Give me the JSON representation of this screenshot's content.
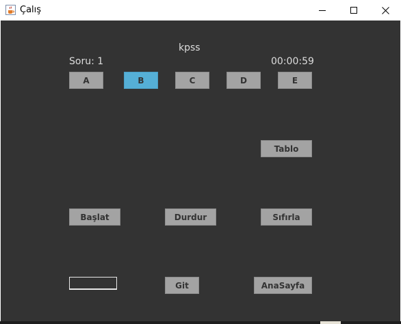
{
  "window": {
    "title": "Çalış",
    "icon": "java-coffee-cup-icon",
    "controls": [
      "minimize-icon",
      "maximize-icon",
      "close-icon"
    ]
  },
  "main": {
    "heading": "kpss",
    "question_label": "Soru: 1",
    "timer": "00:00:59",
    "options": [
      {
        "label": "A",
        "selected": false
      },
      {
        "label": "B",
        "selected": true
      },
      {
        "label": "C",
        "selected": false
      },
      {
        "label": "D",
        "selected": false
      },
      {
        "label": "E",
        "selected": false
      }
    ],
    "buttons": {
      "tablo": "Tablo",
      "baslat": "Başlat",
      "durdur": "Durdur",
      "sifirla": "Sıfırla",
      "git": "Git",
      "anasayfa": "AnaSayfa"
    },
    "goto_input": {
      "value": ""
    }
  },
  "colors": {
    "background": "#333333",
    "button": "#a3a3a3",
    "selected_button": "#55afd6",
    "label_text": "#dddddd"
  }
}
